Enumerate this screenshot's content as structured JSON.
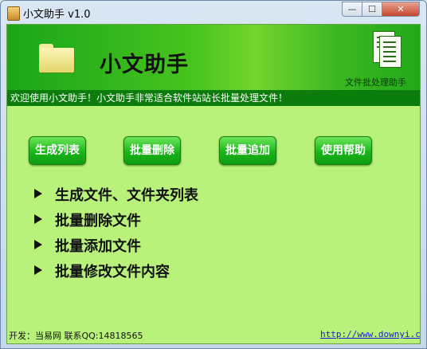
{
  "window": {
    "title": "小文助手 v1.0",
    "controls": {
      "minimize": "—",
      "maximize": "☐",
      "close": "✕"
    }
  },
  "banner": {
    "title": "小文助手",
    "subtitle": "文件批处理助手",
    "icon_left": "folder-icon",
    "icon_right": "documents-icon"
  },
  "notice": "欢迎使用小文助手！小文助手非常适合软件站站长批量处理文件！",
  "buttons": [
    {
      "label": "生成列表"
    },
    {
      "label": "批量删除"
    },
    {
      "label": "批量追加"
    },
    {
      "label": "使用帮助"
    }
  ],
  "features": [
    "生成文件、文件夹列表",
    "批量删除文件",
    "批量添加文件",
    "批量修改文件内容"
  ],
  "footer": {
    "left": "开发：当易网 联系QQ:14818565",
    "right": "http://www.downyi.com"
  },
  "colors": {
    "client_bg": "#b8f27a",
    "banner": "#22a91a",
    "notice_bg": "#0c7d0c",
    "button": "#1ab51a",
    "link": "#1a1ad8"
  }
}
